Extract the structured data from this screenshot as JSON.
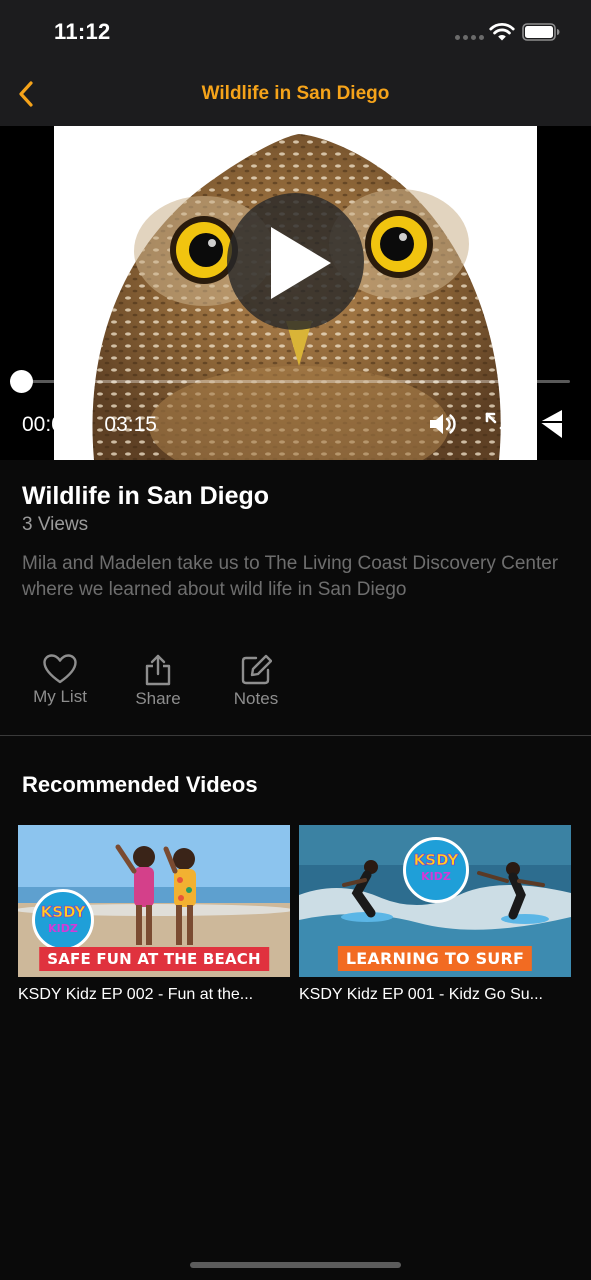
{
  "status_bar": {
    "time": "11:12"
  },
  "nav": {
    "title": "Wildlife in San Diego",
    "back_icon": "chevron-left-icon",
    "accent_color": "#f5a31a"
  },
  "player": {
    "current_time": "00:00",
    "separator": "/",
    "duration": "03:15",
    "progress": 0,
    "play_icon": "play-icon",
    "volume_icon": "volume-icon",
    "fullscreen_icon": "fullscreen-icon",
    "cast_icon": "cast-icon"
  },
  "video": {
    "title": "Wildlife in San Diego",
    "views": "3 Views",
    "description": "Mila and Madelen take us to The Living Coast Discovery Center where we learned about wild life in San Diego"
  },
  "actions": [
    {
      "label": "My List",
      "icon": "heart-icon"
    },
    {
      "label": "Share",
      "icon": "share-icon"
    },
    {
      "label": "Notes",
      "icon": "edit-icon"
    }
  ],
  "recommended": {
    "heading": "Recommended Videos",
    "items": [
      {
        "title": "KSDY Kidz EP 002 - Fun at the...",
        "banner": "SAFE FUN AT THE BEACH",
        "logo_top": "KSDY",
        "logo_bottom": "KIDZ",
        "banner_color": "#e0323e"
      },
      {
        "title": "KSDY Kidz EP 001 - Kidz Go Su...",
        "banner": "LEARNING TO SURF",
        "logo_top": "KSDY",
        "logo_bottom": "KIDZ",
        "banner_color": "#f26b22"
      }
    ]
  }
}
